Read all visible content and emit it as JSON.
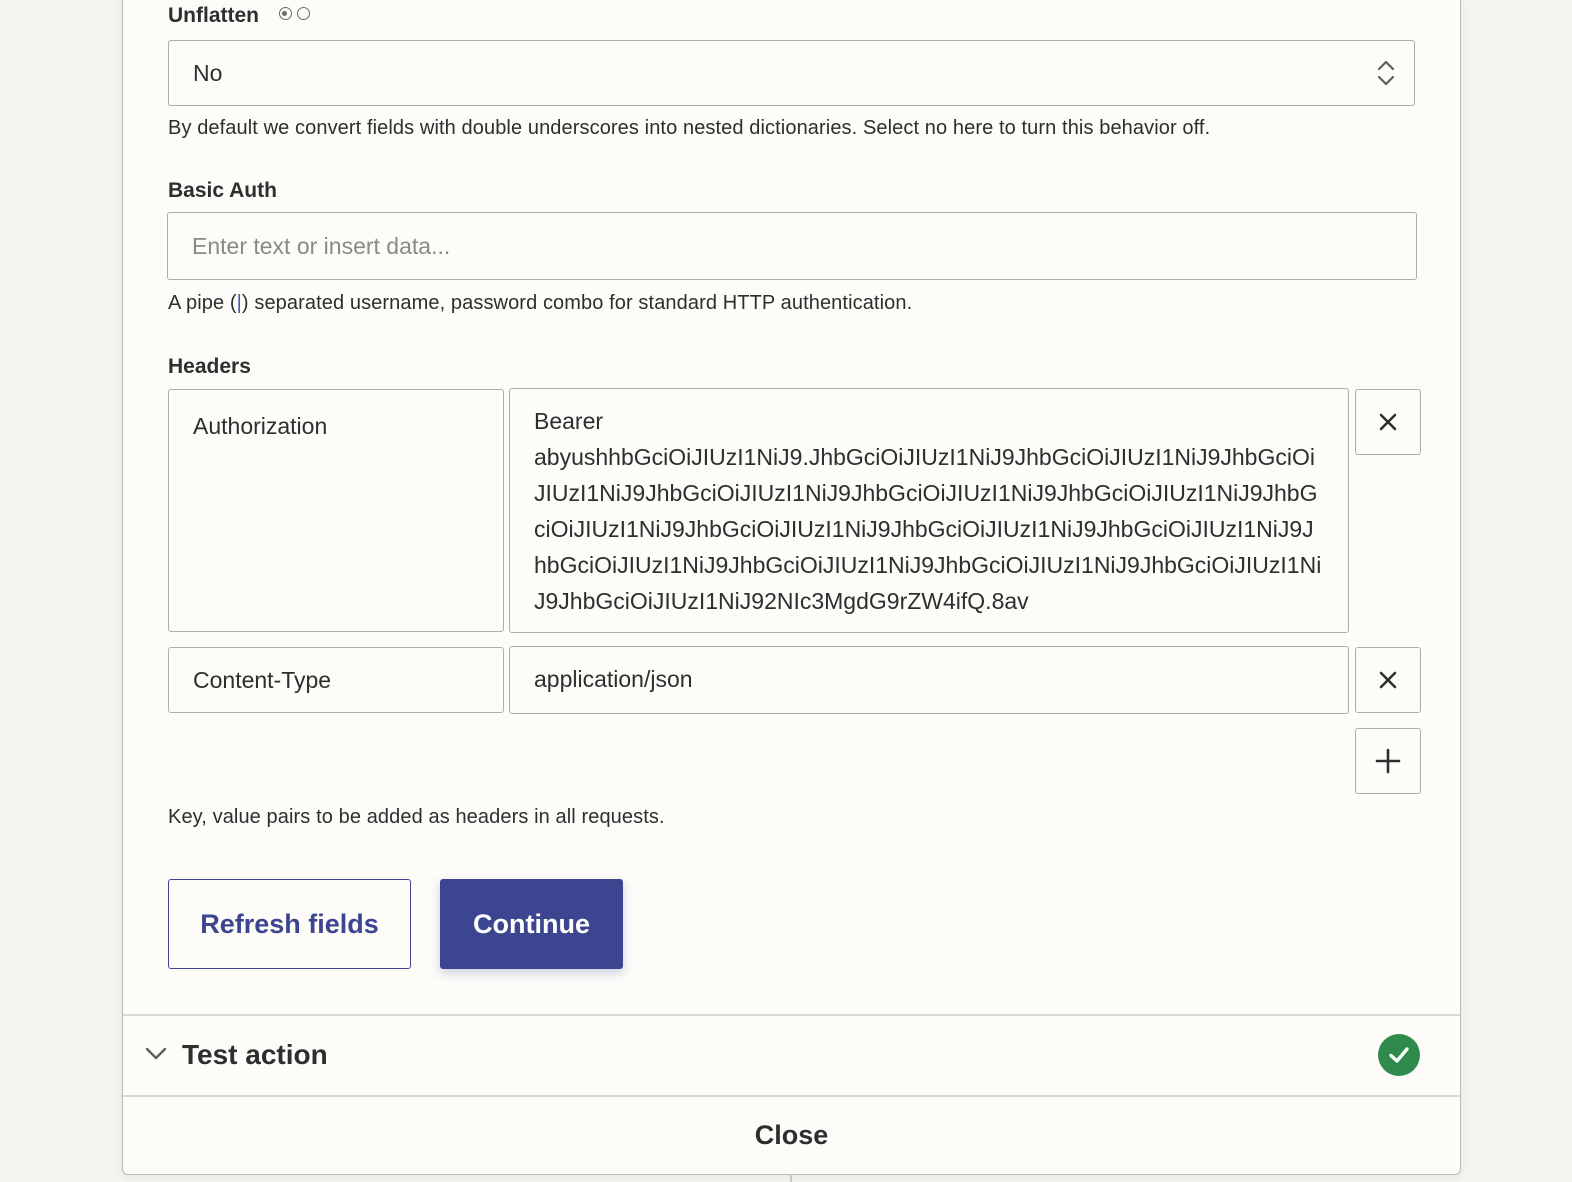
{
  "unflatten": {
    "label": "Unflatten",
    "value": "No",
    "help": "By default we convert fields with double underscores into nested dictionaries. Select no here to turn this behavior off."
  },
  "basic_auth": {
    "label": "Basic Auth",
    "placeholder": "Enter text or insert data...",
    "help_prefix": "A pipe (",
    "help_pipe": "|",
    "help_suffix": ") separated username, password combo for standard HTTP authentication."
  },
  "headers": {
    "label": "Headers",
    "rows": [
      {
        "key": "Authorization",
        "value_line1": "Bearer",
        "value_rest": "abyushhbGciOiJIUzI1NiJ9.JhbGciOiJIUzI1NiJ9JhbGciOiJIUzI1NiJ9JhbGciOiJIUzI1NiJ9JhbGciOiJIUzI1NiJ9JhbGciOiJIUzI1NiJ9JhbGciOiJIUzI1NiJ9JhbGciOiJIUzI1NiJ9JhbGciOiJIUzI1NiJ9JhbGciOiJIUzI1NiJ9JhbGciOiJIUzI1NiJ9JhbGciOiJIUzI1NiJ9JhbGciOiJIUzI1NiJ9JhbGciOiJIUzI1NiJ9JhbGciOiJIUzI1NiJ9JhbGciOiJIUzI1NiJ92NIc3MgdG9rZW4ifQ.8av"
      },
      {
        "key": "Content-Type",
        "value_line1": "application/json",
        "value_rest": ""
      }
    ],
    "help": "Key, value pairs to be added as headers in all requests."
  },
  "buttons": {
    "refresh": "Refresh fields",
    "continue": "Continue"
  },
  "test_action": {
    "title": "Test action",
    "status_icon": "check-circle-icon",
    "status_color": "#2f8a4c"
  },
  "footer": {
    "close": "Close"
  },
  "colors": {
    "accent": "#3d4591",
    "success": "#2f8a4c"
  }
}
